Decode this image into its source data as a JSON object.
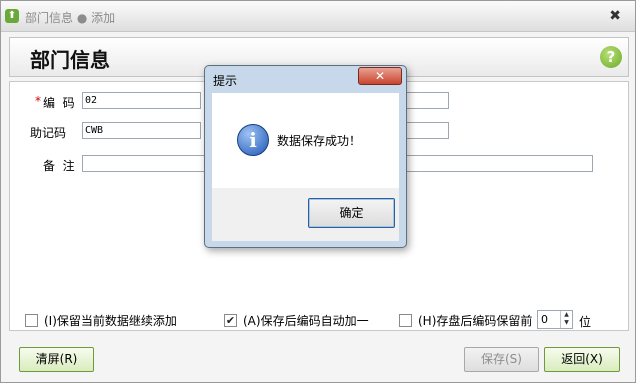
{
  "window": {
    "title": "部门信息 ● 添加",
    "close_glyph": "✖"
  },
  "header": {
    "title": "部门信息",
    "help_glyph": "?"
  },
  "form": {
    "code": {
      "required_mark": "*",
      "label": "编  码",
      "value": "02"
    },
    "mnemonic": {
      "label": "助记码",
      "value": "CWB"
    },
    "remark": {
      "label": "备  注",
      "value": ""
    }
  },
  "options": {
    "keep_adding": {
      "label": "(I)保留当前数据继续添加",
      "checked": false
    },
    "auto_increment": {
      "label": "(A)保存后编码自动加一",
      "checked": true
    },
    "keep_prefix": {
      "label": "(H)存盘后编码保留前",
      "checked": false,
      "digits": "0",
      "unit": "位"
    }
  },
  "buttons": {
    "clear": "清屏(R)",
    "save": "保存(S)",
    "back": "返回(X)"
  },
  "dialog": {
    "title": "提示",
    "close_glyph": "✕",
    "message": "数据保存成功！",
    "ok": "确定"
  }
}
